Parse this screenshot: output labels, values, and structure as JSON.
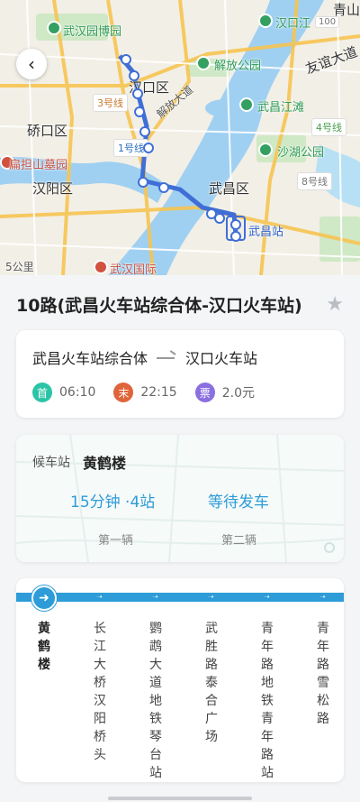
{
  "map": {
    "labels": {
      "hankou_district": "汉口区",
      "qiaokou_district": "硚口区",
      "hanyang_district": "汉阳区",
      "wuchang_district": "武昌区",
      "qingshan": "青山",
      "youyi_avenue": "友谊大道",
      "jiefang_avenue": "解放大道",
      "scale": "5公里"
    },
    "pois": {
      "museum": "武汉园博园",
      "jiefang_park": "解放公园",
      "jiangtan": "武昌江滩",
      "shahu_park": "沙湖公园",
      "bianmu": "扁担山墓园",
      "wuchang_station": "武昌站",
      "hankou_jiang": "汉口江",
      "expo": "武汉国际",
      "tag_100": "100"
    },
    "lines": {
      "line3": "3号线",
      "line1": "1号线",
      "line4": "4号线",
      "line8": "8号线"
    }
  },
  "route": {
    "title": "10路(武昌火车站综合体-汉口火车站)",
    "from": "武昌火车站综合体",
    "to": "汉口火车站",
    "first_badge": "首",
    "first_time": "06:10",
    "last_badge": "末",
    "last_time": "22:15",
    "fare_badge": "票",
    "fare": "2.0元"
  },
  "waiting": {
    "label": "候车站",
    "stop": "黄鹤楼",
    "eta1": "15分钟 ·4站",
    "eta2": "等待发车",
    "vehicle1": "第一辆",
    "vehicle2": "第二辆"
  },
  "stops": [
    {
      "name": "黄鹤楼"
    },
    {
      "name": "长江大桥汉阳桥头"
    },
    {
      "name": "鹦鹉大道地铁琴台站"
    },
    {
      "name": "武胜路泰合广场"
    },
    {
      "name": "青年路地铁青年路站"
    },
    {
      "name": "青年路雪松路"
    }
  ],
  "colors": {
    "accent": "#2d9cd8",
    "route_line": "#3f6fd6",
    "first_badge": "#2cc4a6",
    "last_badge": "#e0643a",
    "fare_badge": "#8a6fe0"
  },
  "icons": {
    "back": "chevron-left-icon",
    "star": "star-icon",
    "arrow": "arrow-right-icon",
    "current": "arrow-right-circle-icon"
  }
}
